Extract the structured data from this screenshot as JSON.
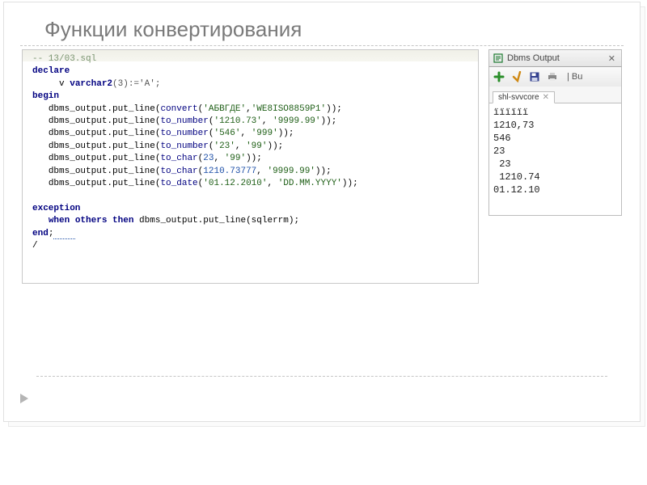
{
  "slide": {
    "title": "Функции конвертирования"
  },
  "code": {
    "filename_comment": "-- 13/03.sql",
    "kw_declare": "declare",
    "var_decl_name": "v ",
    "var_decl_type": "varchar2",
    "var_decl_rest": "(3):='A';",
    "kw_begin": "begin",
    "l1_a": "dbms_output.put_line(",
    "l1_fn": "convert",
    "l1_b": "(",
    "l1_s1": "'АБВГДЕ'",
    "l1_c": ",",
    "l1_s2": "'WE8ISO8859P1'",
    "l1_d": "));",
    "l2_a": "dbms_output.put_line(",
    "l2_fn": "to_number",
    "l2_b": "(",
    "l2_s1": "'1210.73'",
    "l2_c": ", ",
    "l2_s2": "'9999.99'",
    "l2_d": "));",
    "l3_a": "dbms_output.put_line(",
    "l3_fn": "to_number",
    "l3_b": "(",
    "l3_s1": "'546'",
    "l3_c": ", ",
    "l3_s2": "'999'",
    "l3_d": "));",
    "l4_a": "dbms_output.put_line(",
    "l4_fn": "to_number",
    "l4_b": "(",
    "l4_s1": "'23'",
    "l4_c": ", ",
    "l4_s2": "'99'",
    "l4_d": "));",
    "l5_a": "dbms_output.put_line(",
    "l5_fn": "to_char",
    "l5_b": "(",
    "l5_n1": "23",
    "l5_c": ", ",
    "l5_s2": "'99'",
    "l5_d": "));",
    "l6_a": "dbms_output.put_line(",
    "l6_fn": "to_char",
    "l6_b": "(",
    "l6_n1": "1210.73777",
    "l6_c": ", ",
    "l6_s2": "'9999.99'",
    "l6_d": "));",
    "l7_a": "dbms_output.put_line(",
    "l7_fn": "to_date",
    "l7_b": "(",
    "l7_s1": "'01.12.2010'",
    "l7_c": ", ",
    "l7_s2": "'DD.MM.YYYY'",
    "l7_d": "));",
    "kw_exception": "exception",
    "kw_when": "when",
    "kw_others": "others",
    "kw_then": "then",
    "handler_rest": " dbms_output.put_line(sqlerrm);",
    "kw_end": "end",
    "end_semi": ";",
    "slash": "/"
  },
  "output": {
    "header_title": "Dbms Output",
    "toolbar_rest": "| Bu",
    "tab_label": "shl-svvcore",
    "lines": [
      "ïïïïïï",
      "1210,73",
      "546",
      "23",
      " 23",
      " 1210.74",
      "01.12.10"
    ]
  }
}
